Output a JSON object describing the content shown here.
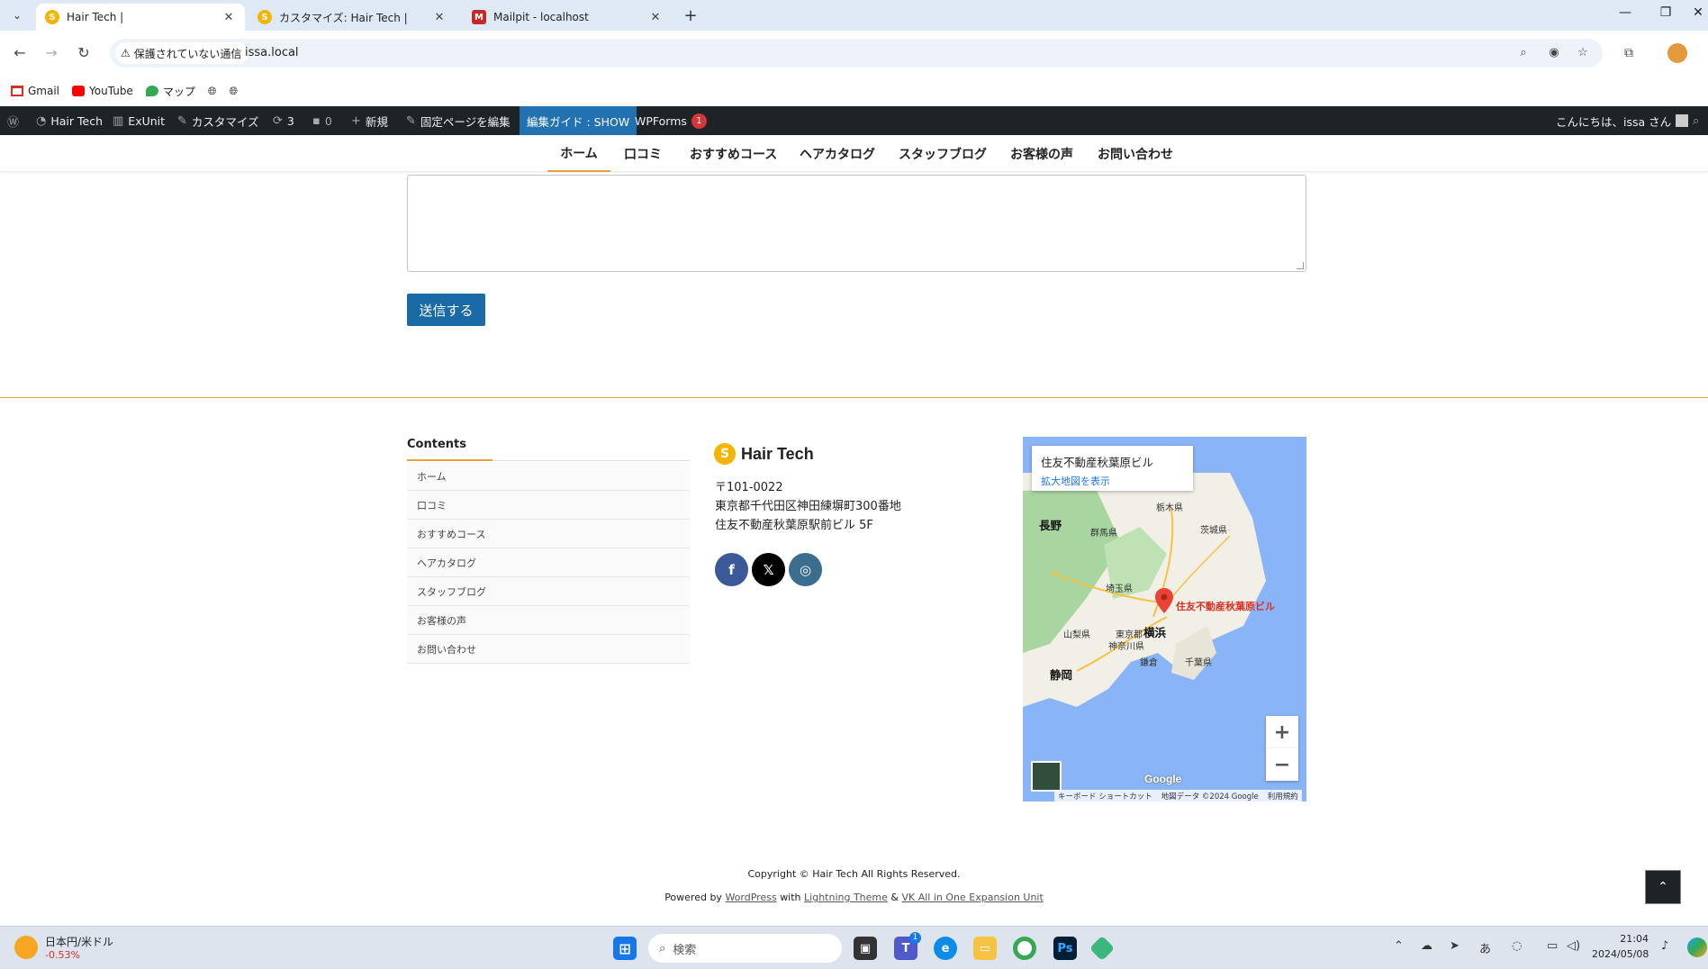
{
  "browser": {
    "tabs": [
      {
        "title": "Hair Tech |",
        "active": true
      },
      {
        "title": "カスタマイズ: Hair Tech |",
        "active": false
      },
      {
        "title": "Mailpit - localhost",
        "active": false
      }
    ],
    "security_label": "保護されていない通信",
    "url": "issa.local"
  },
  "bookmarks": [
    "Gmail",
    "YouTube",
    "マップ"
  ],
  "adminbar": {
    "site": "Hair Tech",
    "exunit": "ExUnit",
    "customize": "カスタマイズ",
    "updates": "3",
    "comments": "0",
    "new": "新規",
    "edit_page": "固定ページを編集",
    "guide": "編集ガイド : SHOW",
    "wpforms": "WPForms",
    "wpforms_badge": "1",
    "greeting": "こんにちは、issa さん"
  },
  "nav": [
    "ホーム",
    "口コミ",
    "おすすめコース",
    "ヘアカタログ",
    "スタッフブログ",
    "お客様の声",
    "お問い合わせ"
  ],
  "form": {
    "submit_label": "送信する"
  },
  "footer": {
    "contents_title": "Contents",
    "menu": [
      "ホーム",
      "口コミ",
      "おすすめコース",
      "ヘアカタログ",
      "スタッフブログ",
      "お客様の声",
      "お問い合わせ"
    ],
    "brand": "Hair Tech",
    "postal": "〒101-0022",
    "address1": "東京都千代田区神田練塀町300番地",
    "address2": "住友不動産秋葉原駅前ビル 5F",
    "social": [
      "facebook-icon",
      "x-icon",
      "instagram-icon"
    ]
  },
  "map": {
    "place": "住友不動産秋葉原ビル",
    "link": "拡大地図を表示",
    "pin_label": "住友不動産秋葉原ビル",
    "labels": [
      "長野",
      "群馬県",
      "栃木県",
      "茨城県",
      "埼玉県",
      "山梨県",
      "東京都",
      "横浜",
      "神奈川県",
      "千葉県",
      "鎌倉",
      "静岡"
    ],
    "zoom_in": "+",
    "zoom_out": "−",
    "google": "Google",
    "attr": [
      "キーボード ショートカット",
      "地図データ ©2024 Google",
      "利用規約"
    ]
  },
  "copyright": "Copyright © Hair Tech All Rights Reserved.",
  "powered": {
    "prefix": "Powered by",
    "wp": "WordPress",
    "with": "with",
    "lightning": "Lightning Theme",
    "amp": "&",
    "vk": "VK All in One Expansion Unit"
  },
  "taskbar": {
    "widget_title": "日本円/米ドル",
    "widget_value": "-0.53%",
    "search_placeholder": "検索",
    "teams_badge": "1",
    "ime": "あ",
    "time": "21:04",
    "date": "2024/05/08"
  },
  "colors": {
    "accent": "#e8a33d",
    "adminbar": "#1d2327",
    "submit": "#1a6aa8",
    "map_water": "#8ab4f8"
  }
}
